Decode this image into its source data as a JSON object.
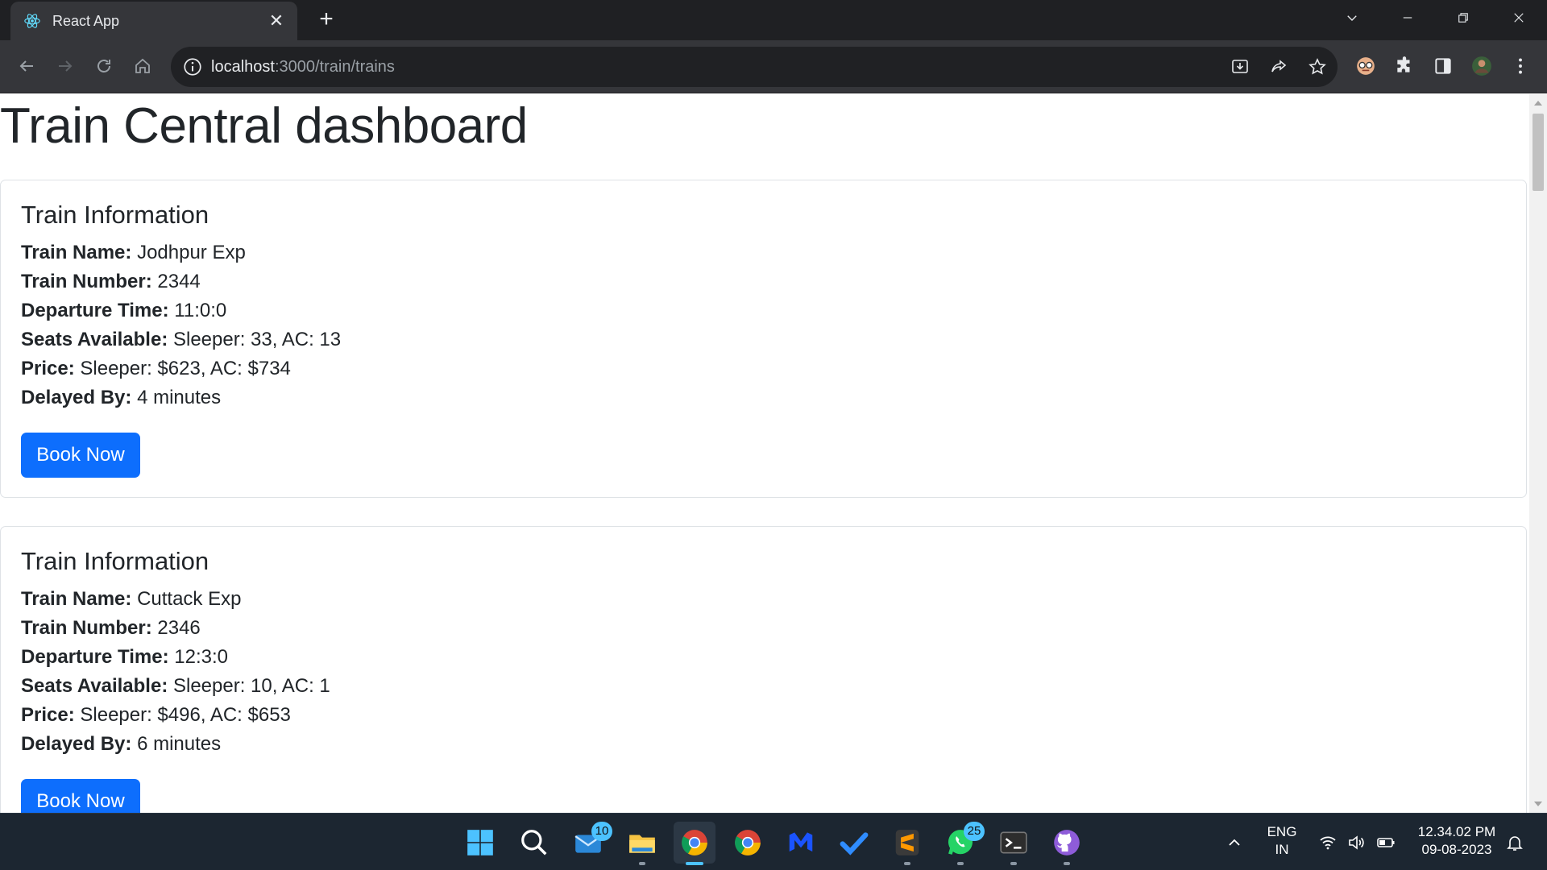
{
  "browser": {
    "tab_title": "React App",
    "url_host": "localhost",
    "url_path": ":3000/train/trains"
  },
  "page": {
    "title": "Train Central dashboard",
    "trains": [
      {
        "card_title": "Train Information",
        "name_label": "Train Name:",
        "name": "Jodhpur Exp",
        "number_label": "Train Number:",
        "number": "2344",
        "departure_label": "Departure Time:",
        "departure": "11:0:0",
        "seats_label": "Seats Available:",
        "seats": "Sleeper: 33, AC: 13",
        "price_label": "Price:",
        "price": "Sleeper: $623, AC: $734",
        "delay_label": "Delayed By:",
        "delay": "4 minutes",
        "button": "Book Now"
      },
      {
        "card_title": "Train Information",
        "name_label": "Train Name:",
        "name": "Cuttack Exp",
        "number_label": "Train Number:",
        "number": "2346",
        "departure_label": "Departure Time:",
        "departure": "12:3:0",
        "seats_label": "Seats Available:",
        "seats": "Sleeper: 10, AC: 1",
        "price_label": "Price:",
        "price": "Sleeper: $496, AC: $653",
        "delay_label": "Delayed By:",
        "delay": "6 minutes",
        "button": "Book Now"
      }
    ]
  },
  "taskbar": {
    "mail_badge": "10",
    "whatsapp_badge": "25",
    "lang_top": "ENG",
    "lang_bottom": "IN",
    "time": "12.34.02 PM",
    "date": "09-08-2023"
  },
  "colors": {
    "primary_button": "#0d6efd",
    "taskbar_bg": "#1c2631",
    "chrome_bg": "#35363a"
  }
}
